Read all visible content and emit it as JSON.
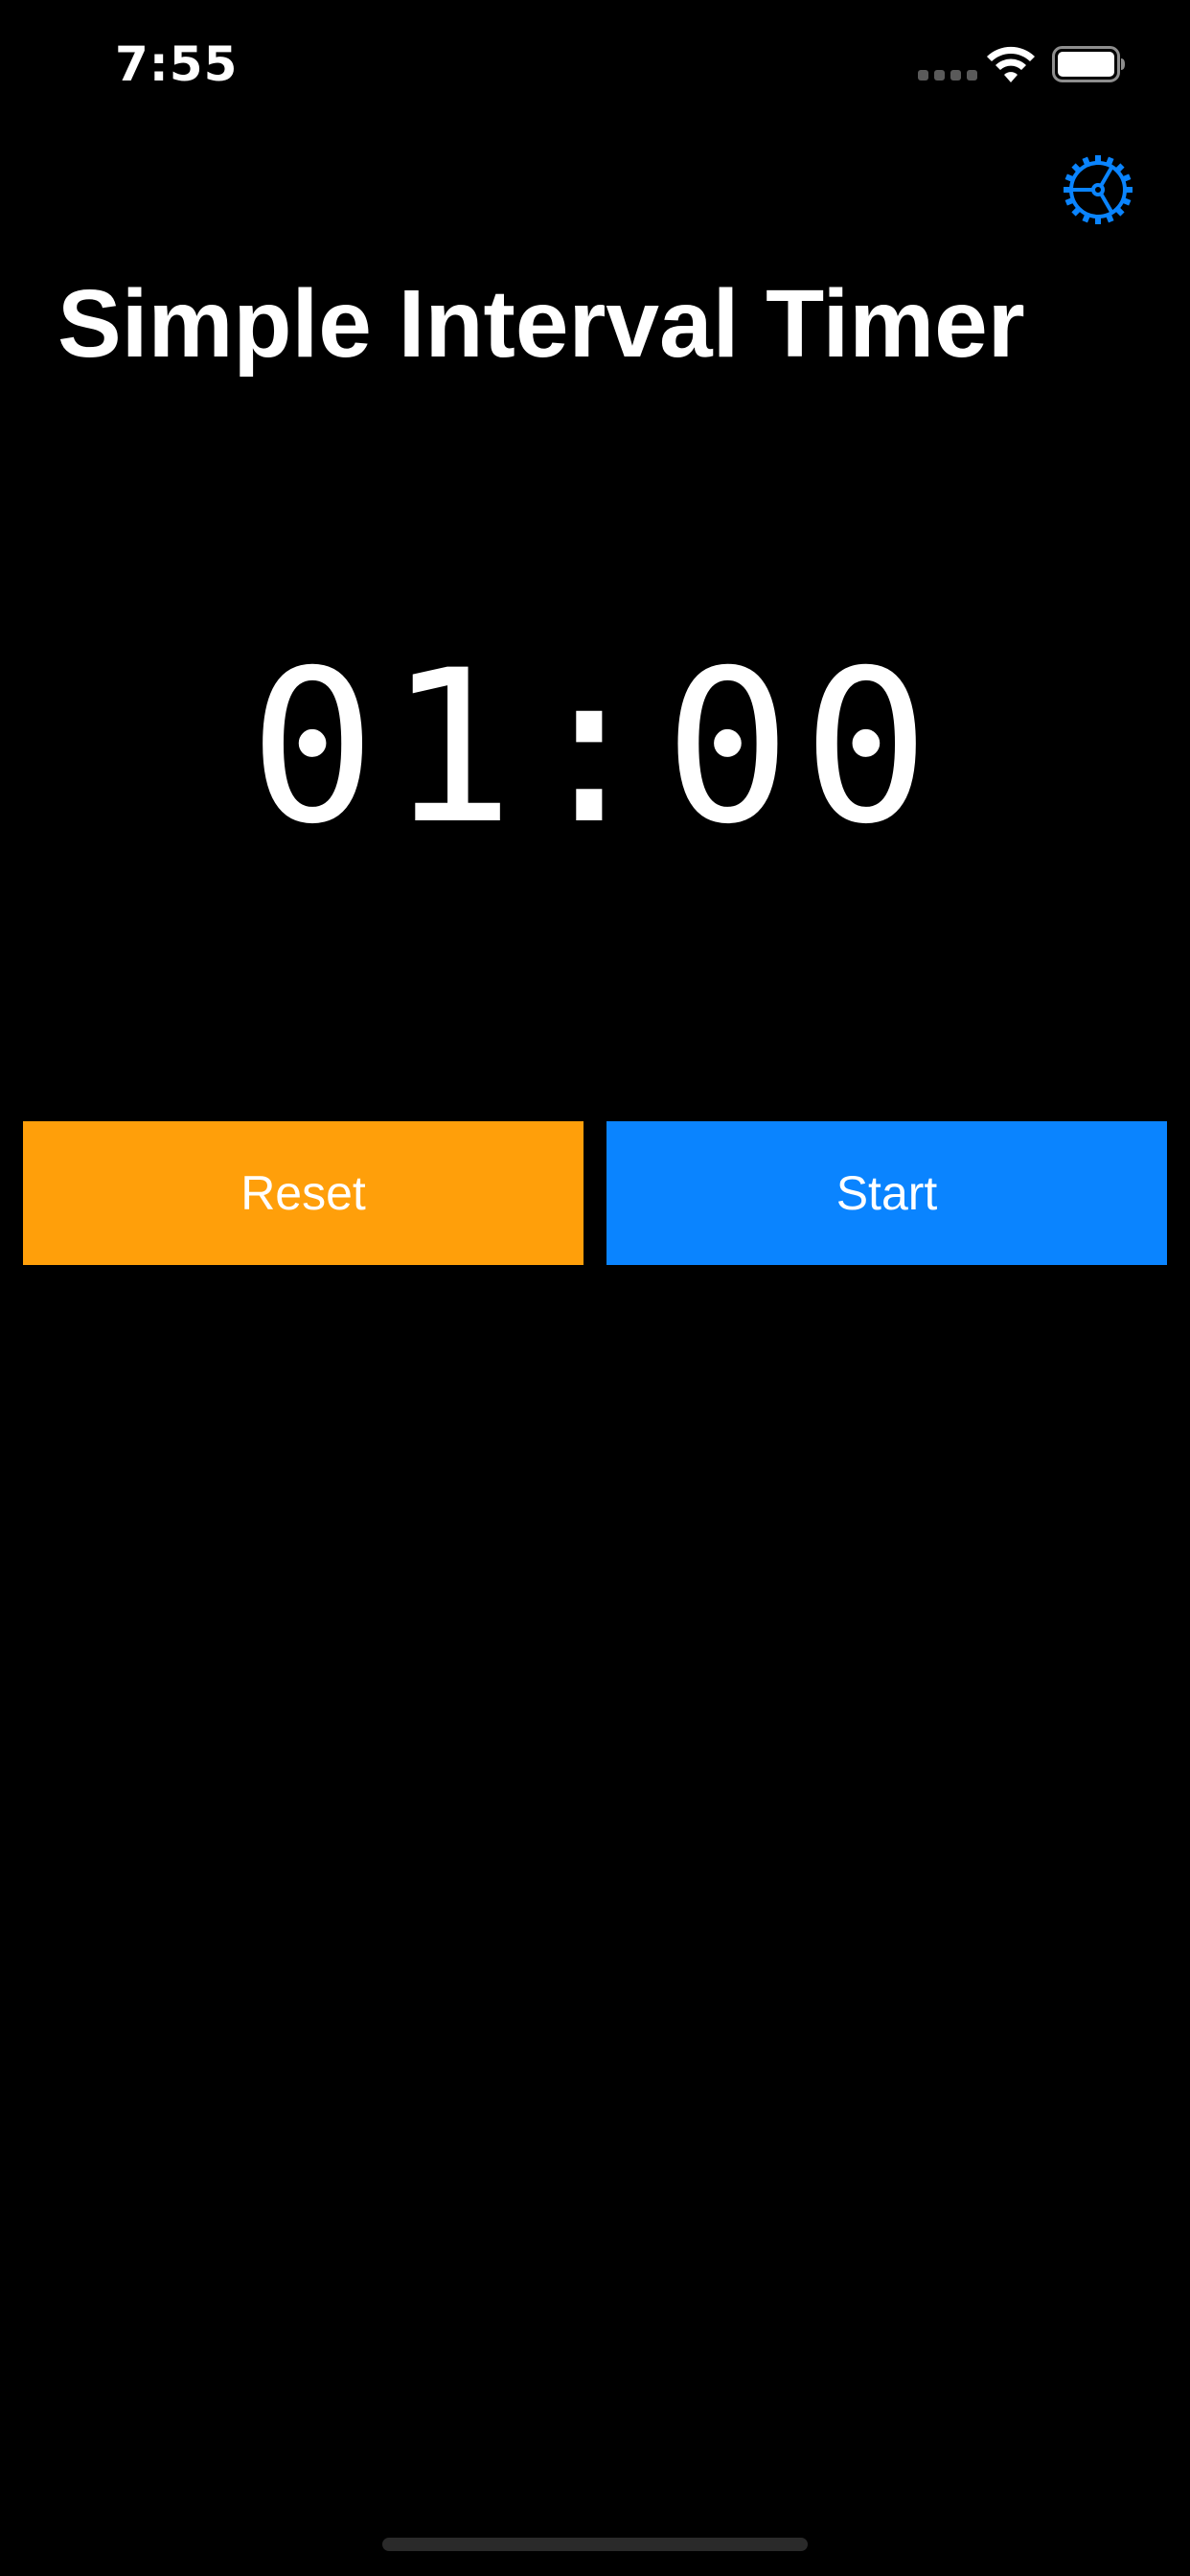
{
  "status_bar": {
    "time": "7:55"
  },
  "header": {
    "title": "Simple Interval Timer"
  },
  "timer": {
    "display": "01:00"
  },
  "controls": {
    "reset_label": "Reset",
    "start_label": "Start"
  },
  "icons": {
    "settings": "gear-icon",
    "wifi": "wifi-icon",
    "battery": "battery-icon",
    "signal": "cellular-signal-icon"
  },
  "colors": {
    "background": "#000000",
    "text": "#FFFFFF",
    "reset": "#FF9F0A",
    "start": "#0A84FF",
    "settings_icon": "#0A84FF"
  }
}
